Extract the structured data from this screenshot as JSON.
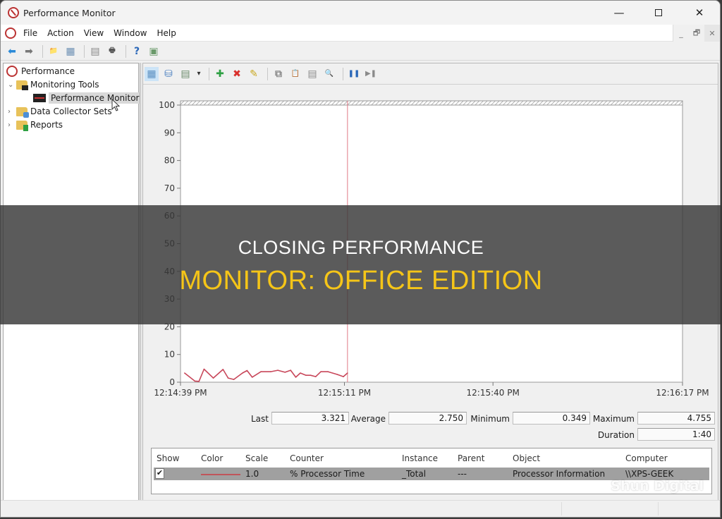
{
  "window": {
    "title": "Performance Monitor",
    "controls": {
      "minimize": "—",
      "maximize": "□",
      "close": "✕"
    }
  },
  "menubar": {
    "items": [
      "File",
      "Action",
      "View",
      "Window",
      "Help"
    ],
    "mdi_controls": {
      "minimize": "_",
      "restore": "🗗",
      "close": "✕"
    }
  },
  "toolbar": {
    "buttons": [
      {
        "name": "back-icon",
        "glyph": "⬅",
        "color": "#2b8ad8"
      },
      {
        "name": "forward-icon",
        "glyph": "➡",
        "color": "#777777"
      },
      {
        "name": "up-folder-icon",
        "glyph": "📁",
        "color": "#d4a31c"
      },
      {
        "name": "show-hide-console-tree-icon",
        "glyph": "▦",
        "color": "#6b8fb3"
      },
      {
        "name": "properties-icon",
        "glyph": "▤",
        "color": "#888888"
      },
      {
        "name": "print-icon",
        "glyph": "🖶",
        "color": "#555555"
      },
      {
        "name": "help-icon",
        "glyph": "?",
        "color": "#2a67b8"
      },
      {
        "name": "show-action-pane-icon",
        "glyph": "▣",
        "color": "#6b9a6b"
      }
    ]
  },
  "tree": {
    "items": [
      {
        "label": "Performance",
        "level": 0,
        "twisty": "",
        "icon": "perf"
      },
      {
        "label": "Monitoring Tools",
        "level": 1,
        "twisty": "⌄",
        "icon": "mt"
      },
      {
        "label": "Performance Monitor",
        "level": 2,
        "twisty": "",
        "icon": "pm",
        "selected": true
      },
      {
        "label": "Data Collector Sets",
        "level": 1,
        "twisty": "›",
        "icon": "dcs"
      },
      {
        "label": "Reports",
        "level": 1,
        "twisty": "›",
        "icon": "rep"
      }
    ]
  },
  "graph_toolbar": {
    "buttons": [
      {
        "name": "view-current-activity-icon",
        "glyph": "▦",
        "color": "#5a8fc0",
        "active": true
      },
      {
        "name": "view-log-data-icon",
        "glyph": "⛁",
        "color": "#4a7fc0"
      },
      {
        "name": "change-graph-type-icon",
        "glyph": "▤",
        "color": "#6a8a6a"
      },
      {
        "name": "graph-type-dropdown-icon",
        "glyph": "▾",
        "color": "#333333"
      },
      {
        "name": "add-counter-icon",
        "glyph": "✚",
        "color": "#2ea043"
      },
      {
        "name": "delete-counter-icon",
        "glyph": "✖",
        "color": "#d9302c"
      },
      {
        "name": "highlight-icon",
        "glyph": "✎",
        "color": "#c9a820"
      },
      {
        "name": "copy-properties-icon",
        "glyph": "⧉",
        "color": "#8a8a8a"
      },
      {
        "name": "paste-counter-list-icon",
        "glyph": "📋",
        "color": "#6a6a6a"
      },
      {
        "name": "properties-icon",
        "glyph": "▤",
        "color": "#8a8a8a"
      },
      {
        "name": "zoom-icon",
        "glyph": "🔍",
        "color": "#8a8a8a"
      },
      {
        "name": "freeze-display-icon",
        "glyph": "❚❚",
        "color": "#2a67b8"
      },
      {
        "name": "update-data-icon",
        "glyph": "▶❚",
        "color": "#8a8a8a"
      }
    ]
  },
  "chart_data": {
    "type": "line",
    "title": "",
    "xlabel": "",
    "ylabel": "",
    "ylim": [
      0,
      100
    ],
    "yticks": [
      0,
      10,
      20,
      30,
      40,
      50,
      60,
      70,
      80,
      90,
      100
    ],
    "xtick_labels": [
      "12:14:39 PM",
      "12:15:11 PM",
      "12:15:40 PM",
      "12:16:17 PM"
    ],
    "time_range_seconds": [
      0,
      98
    ],
    "xtick_seconds": [
      0,
      32,
      61,
      98
    ],
    "current_time_marker_seconds": 32.6,
    "grid": false,
    "series": [
      {
        "name": "% Processor Time",
        "color": "#c8475a",
        "x_seconds": [
          0.8,
          2.8,
          3.6,
          4.6,
          6.4,
          8.3,
          9.3,
          10.4,
          12.1,
          13.0,
          14.0,
          15.7,
          17.6,
          19.0,
          20.4,
          21.5,
          22.5,
          23.4,
          24.5,
          25.4,
          26.4,
          27.4,
          28.8,
          30.6,
          31.8,
          32.6
        ],
        "values": [
          3.3,
          0.4,
          0.3,
          4.7,
          1.5,
          4.6,
          1.5,
          1.0,
          3.3,
          4.2,
          1.8,
          3.8,
          3.8,
          4.3,
          3.6,
          4.3,
          1.8,
          3.3,
          2.5,
          2.5,
          2.0,
          3.8,
          3.8,
          2.8,
          2.0,
          3.3
        ]
      }
    ]
  },
  "stats": {
    "last_label": "Last",
    "last": "3.321",
    "average_label": "Average",
    "average": "2.750",
    "minimum_label": "Minimum",
    "minimum": "0.349",
    "maximum_label": "Maximum",
    "maximum": "4.755",
    "duration_label": "Duration",
    "duration": "1:40"
  },
  "counter_table": {
    "columns": [
      "Show",
      "Color",
      "Scale",
      "Counter",
      "Instance",
      "Parent",
      "Object",
      "Computer"
    ],
    "rows": [
      {
        "show": "✔",
        "color": "#c0555a",
        "scale": "1.0",
        "counter": "% Processor Time",
        "instance": "_Total",
        "parent": "---",
        "object": "Processor Information",
        "computer": "\\\\XPS-GEEK"
      }
    ]
  },
  "overlay": {
    "line1": "CLOSING PERFORMANCE",
    "line2": "MONITOR: OFFICE EDITION",
    "line1_color": "#ffffff",
    "line2_color": "#f5c518"
  },
  "watermark": "Shun Digital"
}
